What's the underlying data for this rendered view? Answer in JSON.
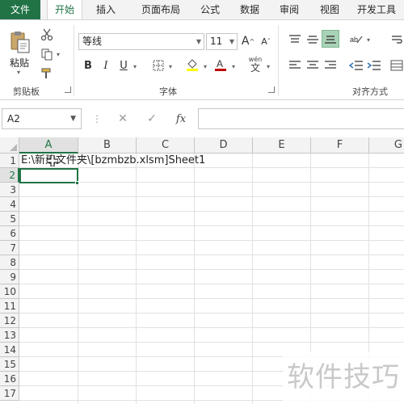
{
  "ribbon_tabs": [
    "文件",
    "开始",
    "插入",
    "页面布局",
    "公式",
    "数据",
    "审阅",
    "视图",
    "开发工具"
  ],
  "clipboard": {
    "paste_label": "粘贴",
    "group_label": "剪贴板"
  },
  "font": {
    "family": "等线",
    "size": "11",
    "grow_label": "A",
    "shrink_label": "A",
    "bold": "B",
    "italic": "I",
    "underline": "U",
    "highlight_color": "#ffff00",
    "font_color": "#c00000",
    "phonetic_top": "wén",
    "phonetic_bottom": "文",
    "group_label": "字体"
  },
  "alignment": {
    "group_label": "对齐方式"
  },
  "formula_bar": {
    "name_box": "A2",
    "cancel": "✕",
    "enter": "✓",
    "fx": "fx",
    "formula": ""
  },
  "sheet": {
    "columns": [
      "A",
      "B",
      "C",
      "D",
      "E",
      "F",
      "G"
    ],
    "rows": [
      "1",
      "2",
      "3",
      "4",
      "5",
      "6",
      "7",
      "8",
      "9",
      "10",
      "11",
      "12",
      "13",
      "14",
      "15",
      "16",
      "17"
    ],
    "cell_a1": "E:\\新建文件夹\\[bzmbzb.xlsm]Sheet1",
    "selected_cell": "A2"
  },
  "watermark": "软件技巧",
  "colors": {
    "accent": "#217346"
  }
}
